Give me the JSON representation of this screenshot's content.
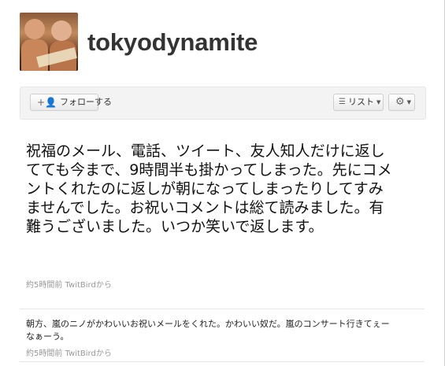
{
  "profile": {
    "username": "tokyodynamite"
  },
  "actions": {
    "follow_label": "フォローする",
    "list_label": "リスト"
  },
  "tweets": [
    {
      "text": "祝福のメール、電話、ツイート、友人知人だけに返してても今まで、9時間半も掛かってしまった。先にコメントくれたのに返しが朝になってしまったりしてすみませんでした。お祝いコメントは総て読みました。有難うございました。いつか笑いで返します。",
      "time": "約5時間前",
      "source": "TwitBirdから"
    },
    {
      "text": "朝方、嵐のニノがかわいいお祝いメールをくれた。かわいい奴だ。嵐のコンサート行きてぇーなぁーう。",
      "time": "約5時間前",
      "source": "TwitBirdから"
    }
  ]
}
